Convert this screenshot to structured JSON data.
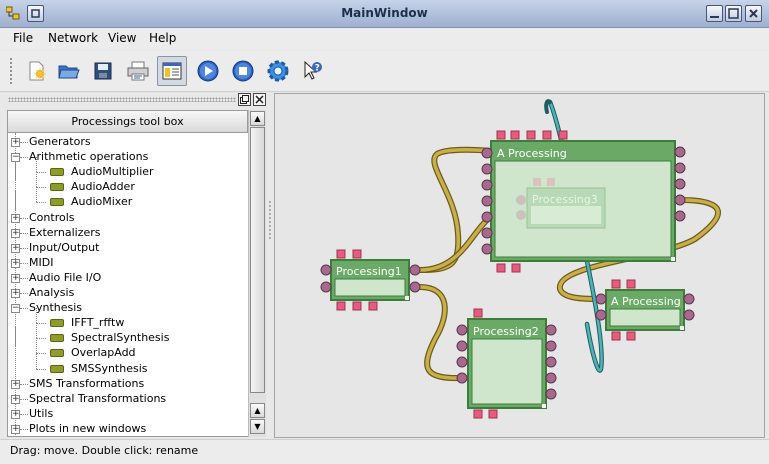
{
  "window": {
    "title": "MainWindow"
  },
  "menu": {
    "file": "File",
    "network": "Network",
    "view": "View",
    "help": "Help"
  },
  "toolbar": {
    "items": [
      "new-network-icon",
      "open-folder-icon",
      "save-disk-icon",
      "print-icon",
      "toolbox-toggle-icon",
      "play-icon",
      "stop-icon",
      "settings-gear-icon",
      "whats-this-icon"
    ]
  },
  "toolbox": {
    "title": "Processings tool box",
    "tree": [
      {
        "label": "Generators",
        "level": 0,
        "expanded": false
      },
      {
        "label": "Arithmetic operations",
        "level": 0,
        "expanded": true
      },
      {
        "label": "AudioMultiplier",
        "level": 1
      },
      {
        "label": "AudioAdder",
        "level": 1
      },
      {
        "label": "AudioMixer",
        "level": 1
      },
      {
        "label": "Controls",
        "level": 0,
        "expanded": false
      },
      {
        "label": "Externalizers",
        "level": 0,
        "expanded": false
      },
      {
        "label": "Input/Output",
        "level": 0,
        "expanded": false
      },
      {
        "label": "MIDI",
        "level": 0,
        "expanded": false
      },
      {
        "label": "Audio File I/O",
        "level": 0,
        "expanded": false
      },
      {
        "label": "Analysis",
        "level": 0,
        "expanded": false
      },
      {
        "label": "Synthesis",
        "level": 0,
        "expanded": true
      },
      {
        "label": "IFFT_rfftw",
        "level": 1
      },
      {
        "label": "SpectralSynthesis",
        "level": 1
      },
      {
        "label": "OverlapAdd",
        "level": 1
      },
      {
        "label": "SMSSynthesis",
        "level": 1
      },
      {
        "label": "SMS Transformations",
        "level": 0,
        "expanded": false
      },
      {
        "label": "Spectral Transformations",
        "level": 0,
        "expanded": false
      },
      {
        "label": "Utils",
        "level": 0,
        "expanded": false
      },
      {
        "label": "Plots in new windows",
        "level": 0,
        "expanded": false
      }
    ]
  },
  "canvas": {
    "boxes": {
      "a_processing_big": "A Processing",
      "processing3": "Processing3",
      "processing1": "Processing1",
      "processing2": "Processing2",
      "a_processing_small": "A Processing"
    },
    "colors": {
      "box": "#6aaa66",
      "box_border": "#3d7c3a",
      "port_in": "#e0607a",
      "port_out": "#a86a8c",
      "wire": "#b09a42",
      "wire_teal": "#3c8f93"
    }
  },
  "status": {
    "text": "Drag: move. Double click: rename"
  }
}
